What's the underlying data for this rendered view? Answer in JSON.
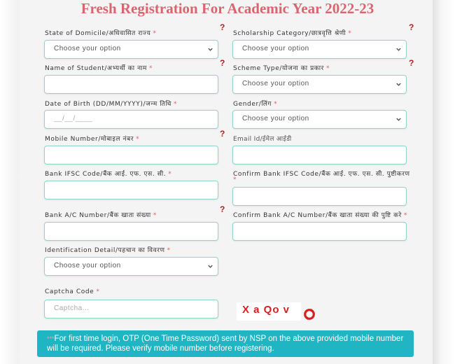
{
  "page": {
    "title": "Fresh Registration For Academic Year 2022-23"
  },
  "form": {
    "state_of_domicile": {
      "label": "State of Domicile/अधिवासित राज्य",
      "value": "Choose your option",
      "required": "*",
      "help": "?"
    },
    "scholarship_category": {
      "label": "Scholarship Category/छात्रवृत्ति श्रेणी",
      "value": "Choose your option",
      "required": "*",
      "help": "?"
    },
    "student_name": {
      "label": "Name of Student/अभ्यर्थी का नाम",
      "value": "",
      "required": "*",
      "help": "?"
    },
    "scheme_type": {
      "label": "Scheme Type/योजना का प्रकार",
      "value": "Choose your option",
      "required": "*",
      "help": "?"
    },
    "date_of_birth": {
      "label": "Date of Birth (DD/MM/YYYY)/जन्म तिथि",
      "placeholder": "__/__/____",
      "required": "*"
    },
    "gender": {
      "label": "Gender/लिंग",
      "value": "Choose your option",
      "required": "*"
    },
    "mobile_number": {
      "label": "Mobile Number/मोबाइल नंबर",
      "value": "",
      "required": "*",
      "help": "?"
    },
    "email": {
      "label": "Email Id/ईमेल आईडी",
      "value": ""
    },
    "bank_ifsc": {
      "label": "Bank IFSC Code/बैंक आई. एफ. एस. सी.",
      "value": "",
      "required": "*"
    },
    "confirm_bank_ifsc": {
      "label": "Confirm Bank IFSC Code/बैंक आई. एफ. एस. सी. पुष्टीकरण",
      "value": "",
      "required": "*"
    },
    "bank_account": {
      "label": "Bank A/C Number/बैंक खाता संख्या",
      "value": "",
      "required": "*",
      "help": "?"
    },
    "confirm_bank_account": {
      "label": "Confirm Bank A/C Number/बैंक खाता संख्या की पुष्टि करे",
      "value": "",
      "required": "*"
    },
    "identification_detail": {
      "label": "Identification Detail/पहचान का विवरण",
      "value": "Choose your option",
      "required": "*"
    },
    "captcha": {
      "label": "Captcha Code",
      "placeholder": "Captcha...",
      "required": "*",
      "image_text": "X a Qo v"
    }
  },
  "notice": {
    "stars": "***",
    "text": "For first time login, OTP (One Time Password) sent by NSP on the above provided mobile number will be required. Please verify mobile number before registering."
  },
  "colors": {
    "title": "#d9666e",
    "field_border": "#8fd3cf",
    "help": "#b02222",
    "notice_bg": "#1fb5c3"
  }
}
